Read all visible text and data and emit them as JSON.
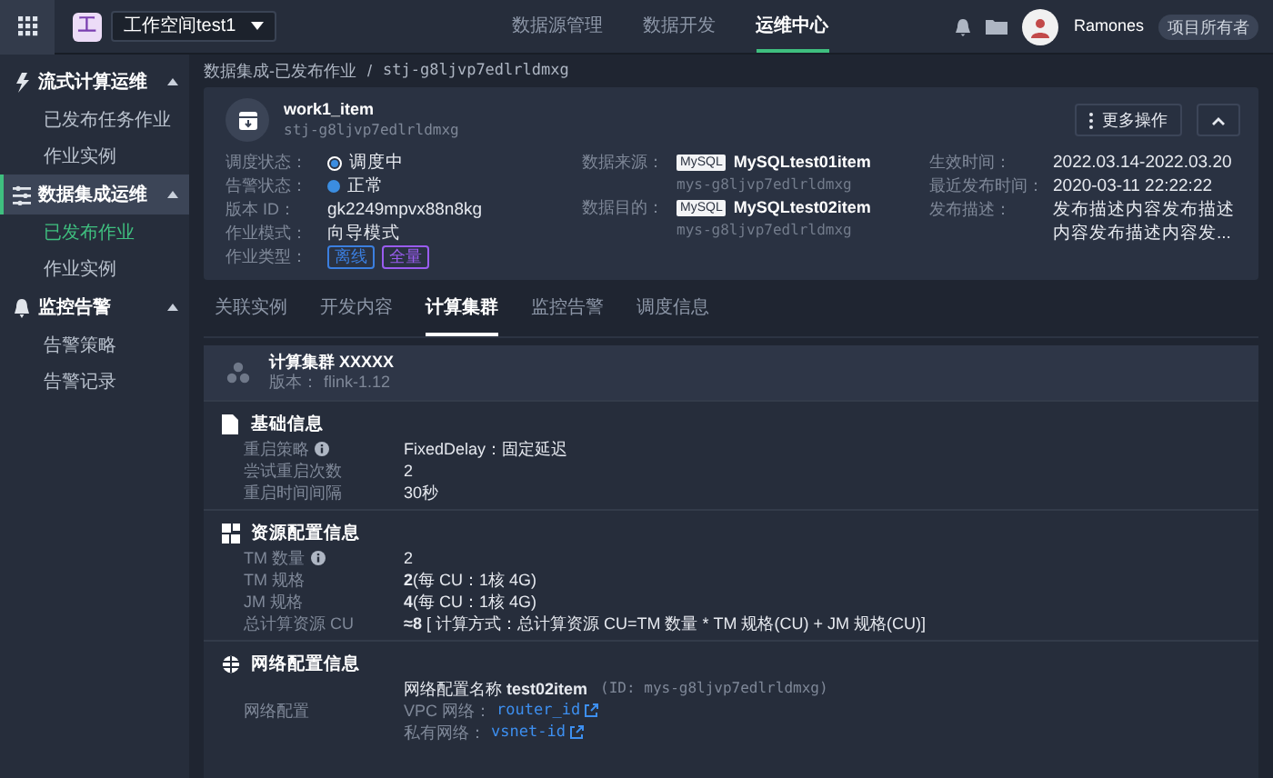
{
  "topbar": {
    "workspace_badge": "工",
    "workspace": "工作空间test1",
    "nav": [
      {
        "label": "数据源管理",
        "selected": false
      },
      {
        "label": "数据开发",
        "selected": false
      },
      {
        "label": "运维中心",
        "selected": true
      }
    ],
    "user": {
      "name": "Ramones",
      "role": "项目所有者"
    }
  },
  "sidebar": {
    "groups": [
      {
        "label": "流式计算运维",
        "expanded": true,
        "selected": false,
        "items": [
          {
            "label": "已发布任务作业",
            "selected": false
          },
          {
            "label": "作业实例",
            "selected": false
          }
        ]
      },
      {
        "label": "数据集成运维",
        "expanded": true,
        "selected": true,
        "items": [
          {
            "label": "已发布作业",
            "selected": true
          },
          {
            "label": "作业实例",
            "selected": false
          }
        ]
      },
      {
        "label": "监控告警",
        "expanded": true,
        "selected": false,
        "items": [
          {
            "label": "告警策略",
            "selected": false
          },
          {
            "label": "告警记录",
            "selected": false
          }
        ]
      }
    ]
  },
  "breadcrumb": {
    "parent": "数据集成-已发布作业",
    "separator": "/",
    "current": "stj-g8ljvp7edlrldmxg"
  },
  "job": {
    "name": "work1_item",
    "id": "stj-g8ljvp7edlrldmxg",
    "more_button": "更多操作",
    "columns": [
      [
        {
          "kind": "radio",
          "label": "调度状态：",
          "value": "调度中",
          "checked": true
        },
        {
          "kind": "status",
          "label": "告警状态：",
          "value": "正常",
          "color": "#3b8de0"
        },
        {
          "kind": "text",
          "label": "版本 ID：",
          "value": "gk2249mpvx88n8kg"
        },
        {
          "kind": "text",
          "label": "作业模式：",
          "value": "向导模式"
        },
        {
          "kind": "tags",
          "label": "作业类型：",
          "tags": [
            {
              "label": "离线",
              "color": "#3b7fe0"
            },
            {
              "label": "全量",
              "color": "#9a5cf0"
            }
          ]
        }
      ],
      [
        {
          "kind": "source",
          "label": "数据来源：",
          "badge": "MySQL",
          "value": "MySQLtest01item",
          "id": "mys-g8ljvp7edlrldmxg"
        },
        {
          "kind": "source",
          "label": "数据目的：",
          "badge": "MySQL",
          "value": "MySQLtest02item",
          "id": "mys-g8ljvp7edlrldmxg"
        }
      ],
      [
        {
          "kind": "text",
          "label": "生效时间：",
          "value": "2022.03.14-2022.03.20"
        },
        {
          "kind": "text",
          "label": "最近发布时间：",
          "value": "2020-03-11 22:22:22"
        },
        {
          "kind": "text",
          "label": "发布描述：",
          "value": "发布描述内容发布描述内容发布描述内容发..."
        }
      ]
    ]
  },
  "tabs": [
    {
      "label": "关联实例",
      "selected": false
    },
    {
      "label": "开发内容",
      "selected": false
    },
    {
      "label": "计算集群",
      "selected": true
    },
    {
      "label": "监控告警",
      "selected": false
    },
    {
      "label": "调度信息",
      "selected": false
    }
  ],
  "cluster": {
    "name": "计算集群 XXXXX",
    "version_label": "版本：",
    "version": "flink-1.12",
    "sections": [
      {
        "title": "基础信息",
        "rows": [
          {
            "kind": "text",
            "label": "重启策略",
            "info": true,
            "value": "FixedDelay：固定延迟"
          },
          {
            "kind": "text",
            "label": "尝试重启次数",
            "info": false,
            "value": "2"
          },
          {
            "kind": "text",
            "label": "重启时间间隔",
            "info": false,
            "value": "30秒"
          }
        ]
      },
      {
        "title": "资源配置信息",
        "rows": [
          {
            "kind": "text",
            "label": "TM 数量",
            "info": true,
            "value": "2"
          },
          {
            "kind": "text",
            "label": "TM 规格",
            "info": false,
            "value": "**2**(每 CU：1核 4G)"
          },
          {
            "kind": "text",
            "label": "JM 规格",
            "info": false,
            "value": "**4**(每 CU：1核 4G)"
          },
          {
            "kind": "text",
            "label": "总计算资源 CU",
            "info": false,
            "value": "**≈8** [ 计算方式：总计算资源 CU=TM 数量 * TM 规格(CU) + JM 规格(CU)]"
          }
        ]
      },
      {
        "title": "网络配置信息",
        "rows": [
          {
            "kind": "network",
            "label": "网络配置",
            "info": false,
            "value": "网络配置名称 **test02item**",
            "note": "(ID: mys-g8ljvp7edlrldmxg)",
            "links": [
              {
                "label": "VPC 网络：",
                "link": "router_id"
              },
              {
                "label": "私有网络：",
                "link": "vsnet-id"
              }
            ]
          }
        ]
      }
    ]
  }
}
